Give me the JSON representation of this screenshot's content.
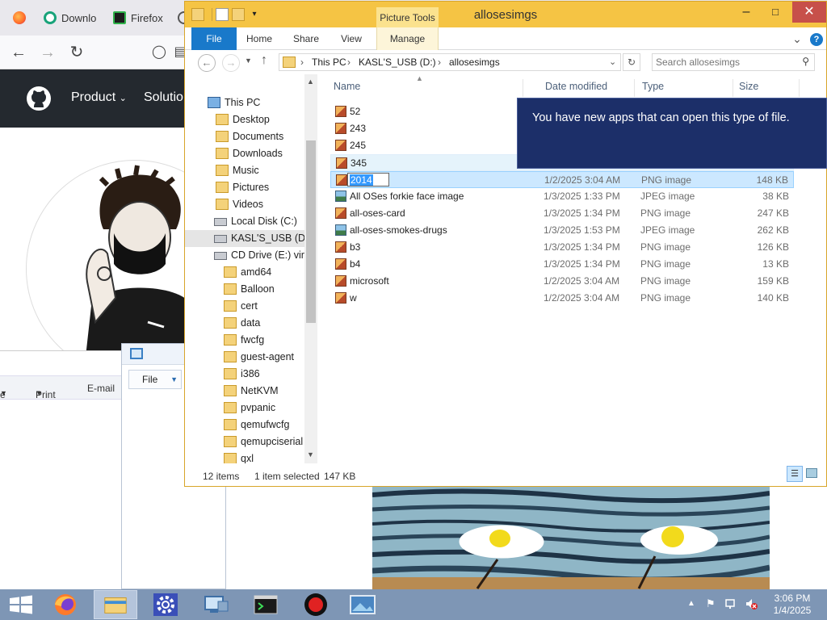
{
  "browser": {
    "tabs": [
      "Downlo",
      "Firefox"
    ],
    "github_nav": [
      "Product",
      "Solutio"
    ]
  },
  "background_windows": {
    "toolbar_left": [
      "e",
      "Print",
      "E-mail"
    ],
    "file_menu": "File"
  },
  "explorer": {
    "title": "allosesimgs",
    "contextual_tab_group": "Picture Tools",
    "ribbon_tabs": [
      "File",
      "Home",
      "Share",
      "View",
      "Manage"
    ],
    "breadcrumbs": [
      "This PC",
      "KASL'S_USB (D:)",
      "allosesimgs"
    ],
    "search_placeholder": "Search allosesimgs",
    "nav_items": [
      {
        "label": "This PC",
        "icon": "pc-icon"
      },
      {
        "label": "Desktop",
        "icon": "folder-icon"
      },
      {
        "label": "Documents",
        "icon": "folder-icon"
      },
      {
        "label": "Downloads",
        "icon": "folder-icon"
      },
      {
        "label": "Music",
        "icon": "folder-icon"
      },
      {
        "label": "Pictures",
        "icon": "folder-icon"
      },
      {
        "label": "Videos",
        "icon": "folder-icon"
      },
      {
        "label": "Local Disk (C:)",
        "icon": "drive-icon"
      },
      {
        "label": "KASL'S_USB (D:)",
        "icon": "usb-drive-icon"
      },
      {
        "label": "CD Drive (E:) virti",
        "icon": "cd-drive-icon"
      },
      {
        "label": "amd64",
        "icon": "folder-icon"
      },
      {
        "label": "Balloon",
        "icon": "folder-icon"
      },
      {
        "label": "cert",
        "icon": "folder-icon"
      },
      {
        "label": "data",
        "icon": "folder-icon"
      },
      {
        "label": "fwcfg",
        "icon": "folder-icon"
      },
      {
        "label": "guest-agent",
        "icon": "folder-icon"
      },
      {
        "label": "i386",
        "icon": "folder-icon"
      },
      {
        "label": "NetKVM",
        "icon": "folder-icon"
      },
      {
        "label": "pvpanic",
        "icon": "folder-icon"
      },
      {
        "label": "qemufwcfg",
        "icon": "folder-icon"
      },
      {
        "label": "qemupciserial",
        "icon": "folder-icon"
      },
      {
        "label": "qxl",
        "icon": "folder-icon"
      }
    ],
    "columns": [
      "Name",
      "Date modified",
      "Type",
      "Size"
    ],
    "files": [
      {
        "name": "52",
        "date": "",
        "type": "",
        "size": "",
        "icon": "png-icon"
      },
      {
        "name": "243",
        "date": "",
        "type": "",
        "size": "",
        "icon": "png-icon"
      },
      {
        "name": "245",
        "date": "",
        "type": "",
        "size": "",
        "icon": "png-icon"
      },
      {
        "name": "345",
        "date": "",
        "type": "",
        "size": "",
        "icon": "png-icon"
      },
      {
        "name": "2014",
        "date": "1/2/2025 3:04 AM",
        "type": "PNG image",
        "size": "148 KB",
        "icon": "png-icon"
      },
      {
        "name": "All OSes forkie face image",
        "date": "1/3/2025 1:33 PM",
        "type": "JPEG image",
        "size": "38 KB",
        "icon": "jpeg-icon"
      },
      {
        "name": "all-oses-card",
        "date": "1/3/2025 1:34 PM",
        "type": "PNG image",
        "size": "247 KB",
        "icon": "png-icon"
      },
      {
        "name": "all-oses-smokes-drugs",
        "date": "1/3/2025 1:53 PM",
        "type": "JPEG image",
        "size": "262 KB",
        "icon": "jpeg-icon"
      },
      {
        "name": "b3",
        "date": "1/3/2025 1:34 PM",
        "type": "PNG image",
        "size": "126 KB",
        "icon": "png-icon"
      },
      {
        "name": "b4",
        "date": "1/3/2025 1:34 PM",
        "type": "PNG image",
        "size": "13 KB",
        "icon": "png-icon"
      },
      {
        "name": "microsoft",
        "date": "1/2/2025 3:04 AM",
        "type": "PNG image",
        "size": "159 KB",
        "icon": "png-icon"
      },
      {
        "name": "w",
        "date": "1/2/2025 3:04 AM",
        "type": "PNG image",
        "size": "140 KB",
        "icon": "png-icon"
      }
    ],
    "status": {
      "items": "12 items",
      "selected": "1 item selected",
      "size": "147 KB"
    },
    "toast": "You have new apps that can open this type of file."
  },
  "taskbar": {
    "clock_time": "3:06 PM",
    "clock_date": "1/4/2025"
  },
  "colors": {
    "explorer_frame": "#f5c444",
    "file_tab": "#1979ca",
    "selection": "#cce8ff",
    "toast_bg": "#1c2f69",
    "taskbar": "#7e96b5",
    "github_header": "#24292f"
  }
}
